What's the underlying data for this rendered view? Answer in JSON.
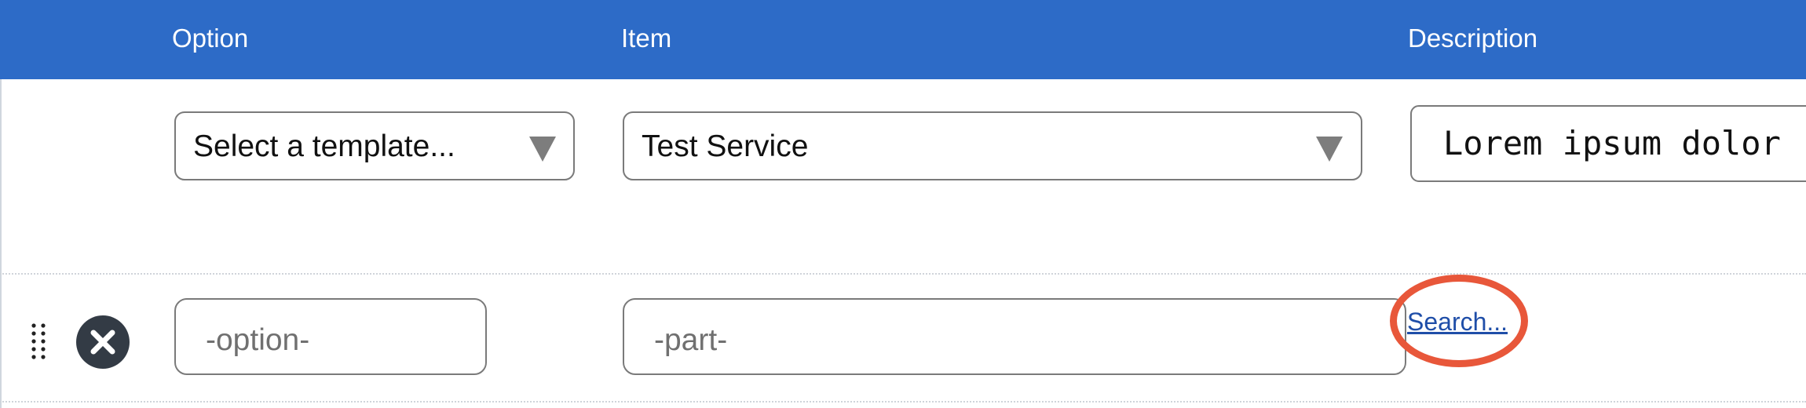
{
  "header": {
    "option": "Option",
    "item": "Item",
    "description": "Description",
    "background": "#2d6bc7"
  },
  "row1": {
    "template_select": {
      "value": "Select a template..."
    },
    "item_select": {
      "value": "Test Service"
    },
    "description_value": "Lorem ipsum dolor"
  },
  "row2": {
    "option_placeholder": "-option-",
    "part_placeholder": "-part-",
    "search_link": "Search...",
    "remove_icon": "close-icon",
    "drag_icon": "drag-handle-icon"
  },
  "colors": {
    "highlight": "#e8573a",
    "link": "#1f4ea8",
    "remove_button": "#333b45"
  }
}
